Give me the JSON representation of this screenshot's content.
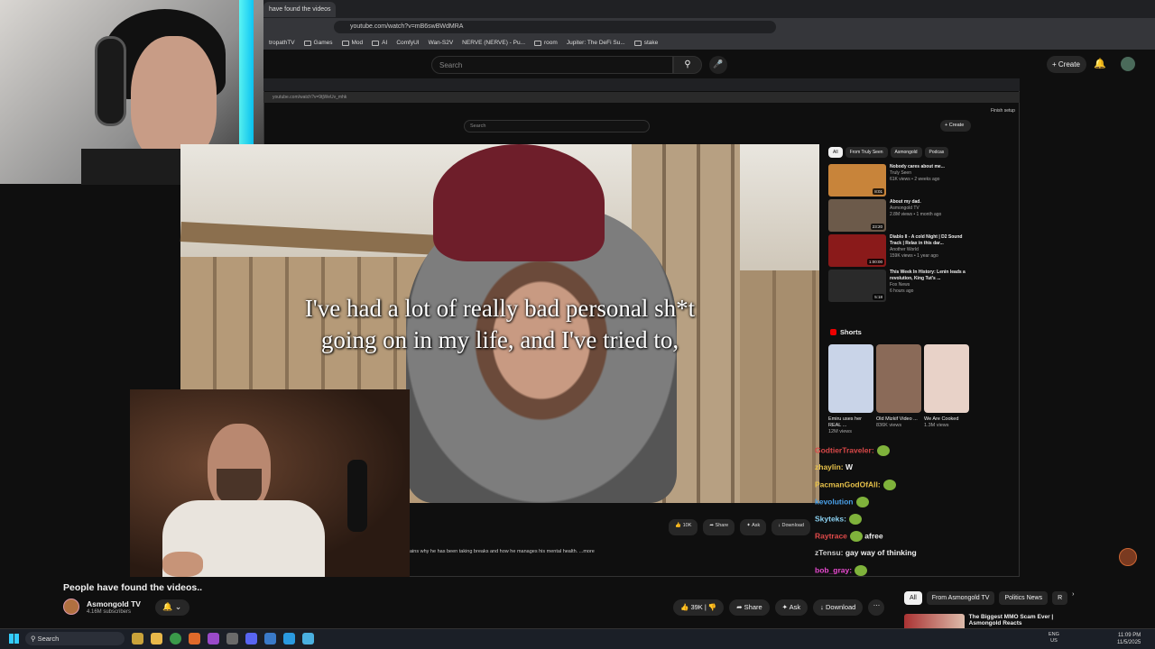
{
  "browser": {
    "active_tab": "have found the videos",
    "url": "youtube.com/watch?v=mB6swBWdMRA",
    "bookmarks": [
      "tropathTV",
      "Games",
      "Mod",
      "AI",
      "ComfyUI",
      "Wan-S2V",
      "NERVE (NERVE) - Pu...",
      "room",
      "Jupiter: The DeFi Su...",
      "stake"
    ]
  },
  "youtube": {
    "search_placeholder": "Search",
    "create_label": "Create",
    "video_title": "People have found the videos..",
    "channel_name": "Asmongold TV",
    "subscribers": "4.16M subscribers",
    "likes": "39K",
    "share_label": "Share",
    "ask_label": "Ask",
    "download_label": "Download",
    "chips": [
      "All",
      "From Asmongold TV",
      "Politics News",
      "R"
    ],
    "next_video_title": "The Biggest MMO Scam Ever | Asmongold Reacts"
  },
  "inner": {
    "url": "youtube.com/watch?v=9tjWeUv_mhk",
    "search_placeholder": "Search",
    "create_label": "Create",
    "finish_setup": "Finish setup",
    "sign_in": "Sign in",
    "caption_line1": "I've had a lot of really bad personal sh*t",
    "caption_line2": "going on in my life, and I've tried to,",
    "likes": "10K",
    "share_label": "Share",
    "ask_label": "Ask",
    "download_label": "Download",
    "description": "ains why he has been taking breaks and how he manages his mental health. ...more",
    "chips": [
      "All",
      "From Truly Seen",
      "Asmongold",
      "Podcas"
    ],
    "recs": [
      {
        "title": "Nobody cares about me...",
        "channel": "Truly Seen",
        "meta": "61K views • 2 weeks ago",
        "duration": "8:01",
        "color": "#c8843a"
      },
      {
        "title": "About my dad.",
        "channel": "Asmongold TV",
        "meta": "2.8M views • 1 month ago",
        "duration": "23:20",
        "color": "#6c5a4a"
      },
      {
        "title": "Diablo II - A cold Night | D2 Sound Track | Relax in this dar...",
        "channel": "Another World",
        "meta": "159K views • 1 year ago",
        "duration": "1:00:00",
        "color": "#8a1a1a"
      },
      {
        "title": "This Week In History: Lenin leads a revolution, King Tut's ...",
        "channel": "Fox News",
        "meta": "6 hours ago",
        "duration": "5:18",
        "color": "#2a2a2a"
      }
    ],
    "shorts_title": "Shorts",
    "shorts": [
      {
        "title": "Emiru uses her REAL ...",
        "views": "12M views",
        "color": "#c9d4e8"
      },
      {
        "title": "Old Mizkif Video ...",
        "views": "836K views",
        "color": "#8a6a58"
      },
      {
        "title": "We Are Cooked",
        "views": "1.3M views",
        "color": "#e8d2c8"
      }
    ]
  },
  "chat": [
    {
      "user": "GodtierTraveler:",
      "msg": "",
      "color": "#d94848",
      "emote": true
    },
    {
      "user": "zhaylin:",
      "msg": "W",
      "color": "#e8c24a",
      "emote": false
    },
    {
      "user": "PacmanGodOfAll:",
      "msg": "",
      "color": "#e8c24a",
      "emote": true
    },
    {
      "user": "kevolution",
      "msg": "",
      "color": "#4aa0e8",
      "emote": true
    },
    {
      "user": "Skyteks:",
      "msg": "",
      "color": "#8ad0f0",
      "emote": true
    },
    {
      "user": "Raytrace",
      "msg": "afree",
      "color": "#e04a4a",
      "emote": true
    },
    {
      "user": "zTensu:",
      "msg": "gay way of thinking",
      "color": "#cccccc",
      "emote": false
    },
    {
      "user": "bob_gray:",
      "msg": "",
      "color": "#e94ad0",
      "emote": true
    }
  ],
  "taskbar": {
    "search_label": "Search",
    "lang": "ENG",
    "region": "US",
    "time": "11:09 PM",
    "date": "11/5/2025"
  }
}
